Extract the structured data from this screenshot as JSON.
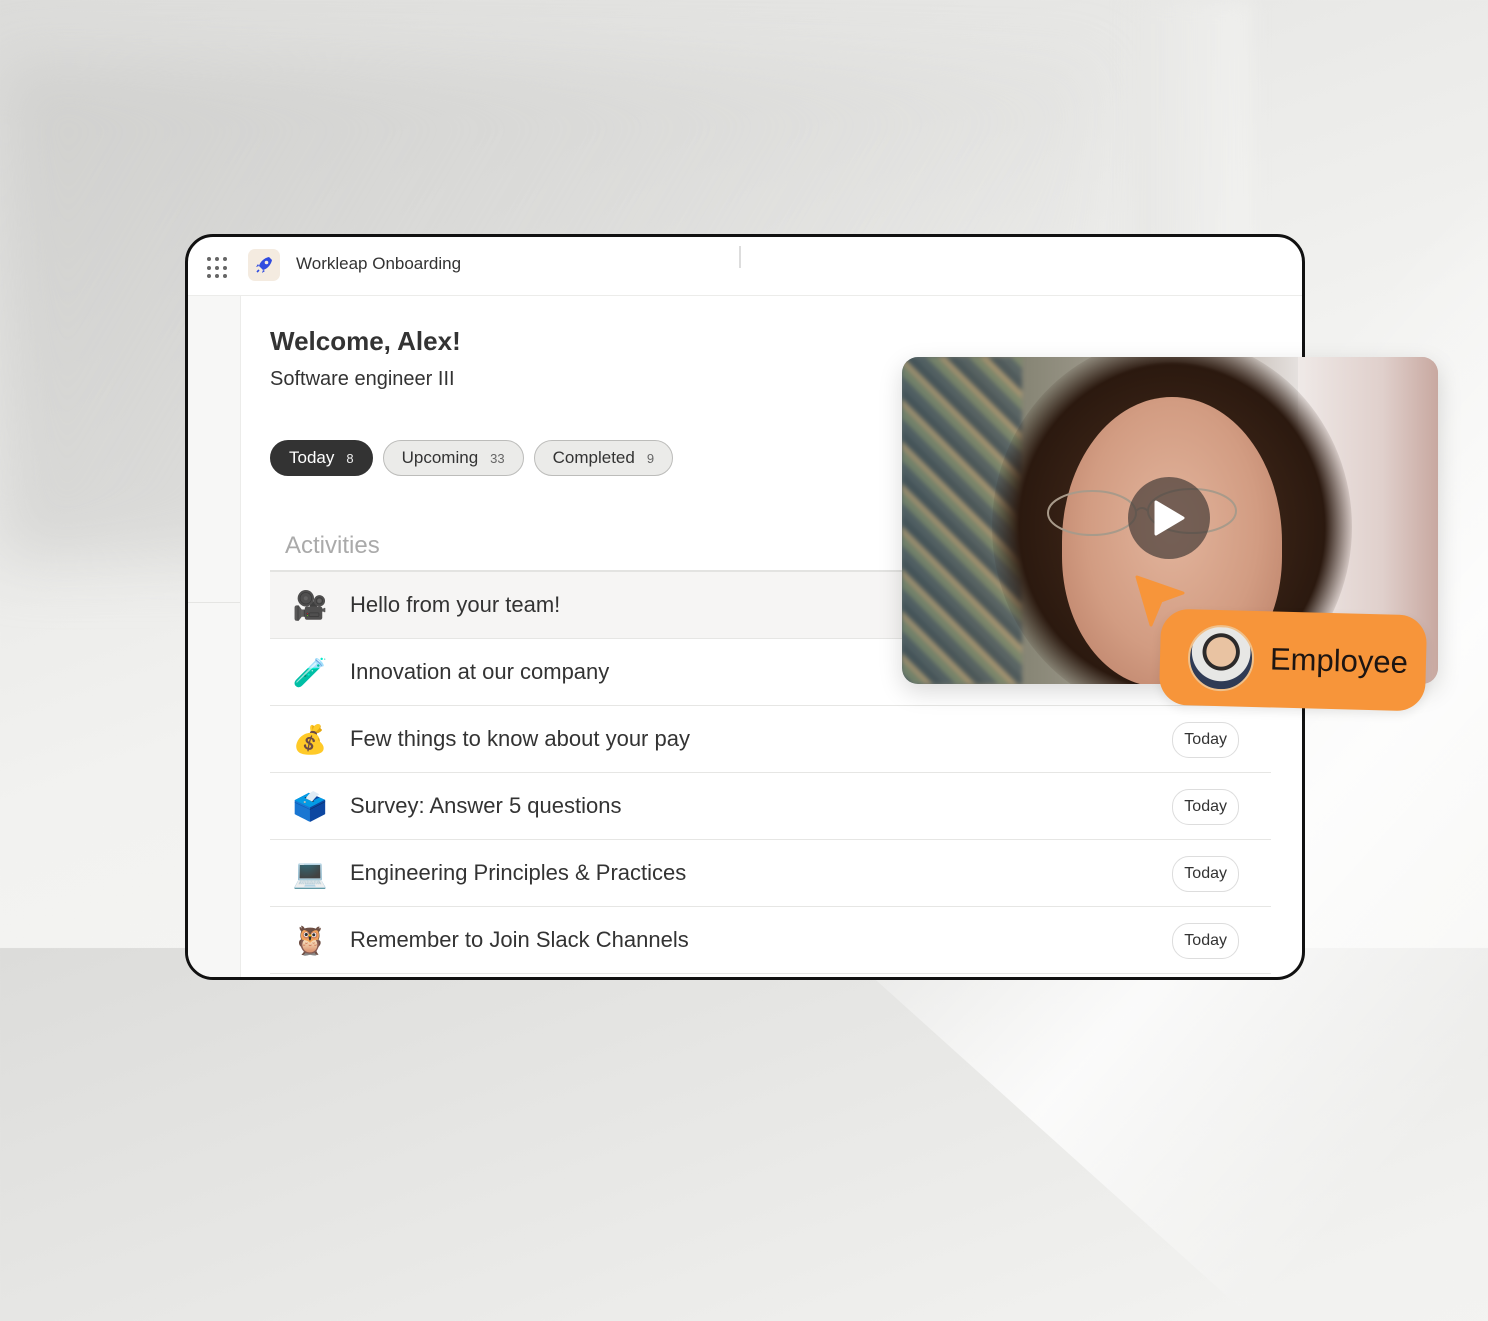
{
  "app": {
    "title": "Workleap Onboarding",
    "logo_icon": "rocket-icon",
    "launcher_icon": "grid-icon"
  },
  "header": {
    "welcome": "Welcome, Alex!",
    "role": "Software engineer III"
  },
  "tabs": [
    {
      "label": "Today",
      "count": "8",
      "active": true
    },
    {
      "label": "Upcoming",
      "count": "33",
      "active": false
    },
    {
      "label": "Completed",
      "count": "9",
      "active": false
    }
  ],
  "activities": {
    "header": "Activities",
    "items": [
      {
        "emoji": "🎥",
        "icon": "movie-camera-icon",
        "title": "Hello from your team!",
        "badge": ""
      },
      {
        "emoji": "🧪",
        "icon": "test-tube-icon",
        "title": "Innovation at our company",
        "badge": ""
      },
      {
        "emoji": "💰",
        "icon": "money-bag-icon",
        "title": "Few things to know about your pay",
        "badge": "Today"
      },
      {
        "emoji": "🗳️",
        "icon": "ballot-box-icon",
        "title": "Survey: Answer 5 questions",
        "badge": "Today"
      },
      {
        "emoji": "💻",
        "icon": "laptop-icon",
        "title": "Engineering Principles & Practices",
        "badge": "Today"
      },
      {
        "emoji": "🦉",
        "icon": "owl-icon",
        "title": "Remember to Join Slack Channels",
        "badge": "Today"
      }
    ]
  },
  "video": {
    "play_icon": "play-icon"
  },
  "employee_tag": {
    "label": "Employee"
  },
  "colors": {
    "accent_orange": "#f7953a",
    "active_tab": "#333333",
    "logo_blue": "#2f4be0"
  }
}
